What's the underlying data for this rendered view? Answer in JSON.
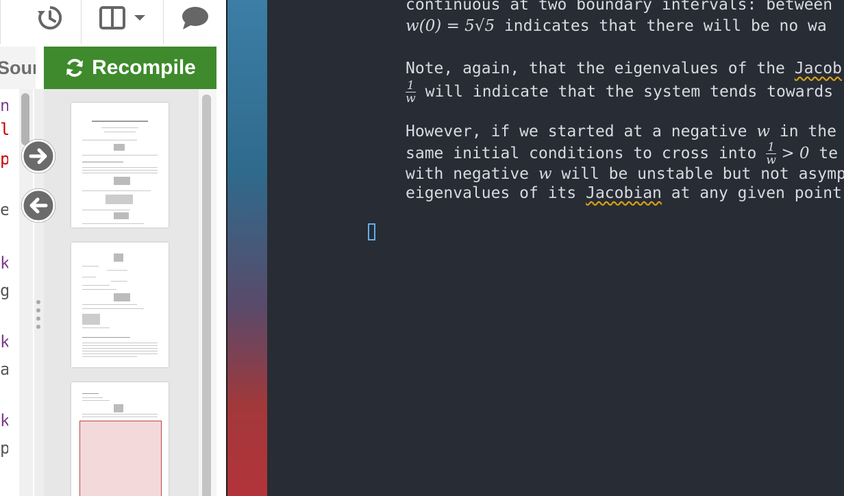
{
  "toolbar": {
    "history_icon": "history-icon",
    "layout_icon": "split-layout-icon",
    "chat_icon": "chat-icon"
  },
  "source_tab": {
    "label": "Sourc"
  },
  "recompile": {
    "label": "Recompile",
    "icon": "refresh-icon"
  },
  "editor_fragments": [
    "n",
    "l",
    "p",
    "e",
    "k",
    "g",
    "k",
    "a",
    "k",
    "p"
  ],
  "navigation": {
    "forward_icon": "arrow-right-icon",
    "back_icon": "arrow-left-icon"
  },
  "pdf_preview": {
    "page1_title": "MATH 3301 Module 3: Research Question",
    "pages": 3
  },
  "terminal": {
    "line1": "continuous at two boundary intervals: between",
    "line2_math": "w(0) = 5√5",
    "line2_text": " indicates that there will be no wa",
    "line3a": "Note, again, that the eigenvalues of the ",
    "line3b": "Jacob",
    "line4_frac_num": "1",
    "line4_frac_den": "w",
    "line4_text": " will indicate that the system tends towards",
    "line5a": "However, if we started at a negative ",
    "line5_math": "w",
    "line5b": " in the",
    "line6a": "same initial conditions to cross into ",
    "line6_frac_num": "1",
    "line6_frac_den": "w",
    "line6_math": " > 0",
    "line6b": " te",
    "line7a": "with negative ",
    "line7_math": "w",
    "line7b": " will be unstable but not asymp",
    "line8a": "eigenvalues of its ",
    "line8_squig": "Jacobian",
    "line8b": " at any given point"
  }
}
